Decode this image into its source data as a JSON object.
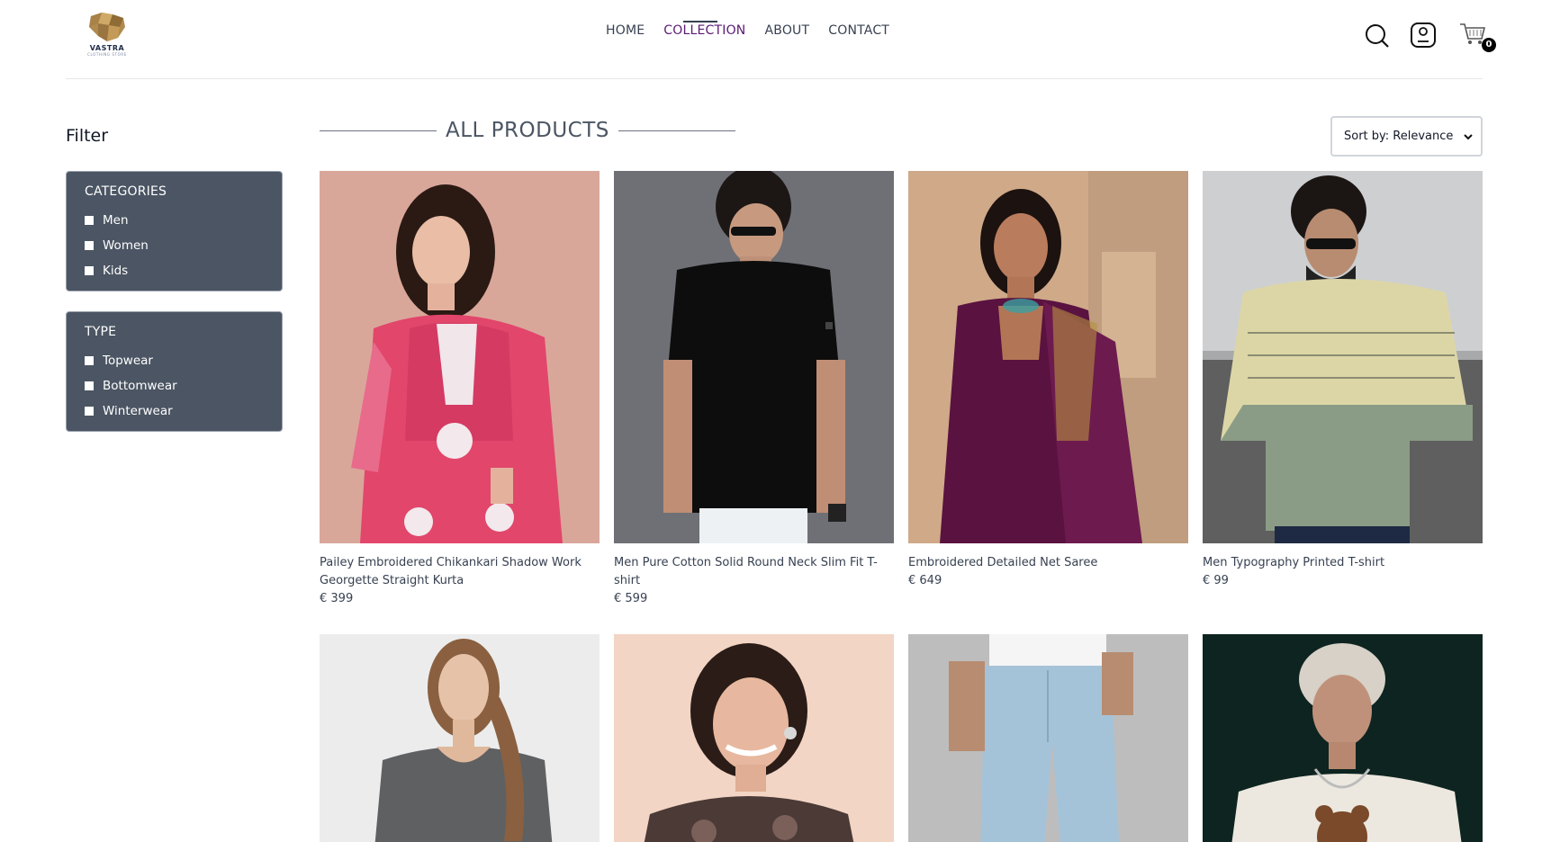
{
  "brand": {
    "name": "VASTRA",
    "tagline": "CLOTHING STORE"
  },
  "nav": {
    "items": [
      {
        "label": "HOME",
        "active": false
      },
      {
        "label": "COLLECTION",
        "active": true
      },
      {
        "label": "ABOUT",
        "active": false
      },
      {
        "label": "CONTACT",
        "active": false
      }
    ]
  },
  "header_icons": {
    "search": "search-icon",
    "profile": "user-icon",
    "cart": "cart-icon",
    "cart_count": "0"
  },
  "filter": {
    "title": "Filter",
    "categories": {
      "heading": "CATEGORIES",
      "options": [
        "Men",
        "Women",
        "Kids"
      ]
    },
    "type": {
      "heading": "TYPE",
      "options": [
        "Topwear",
        "Bottomwear",
        "Winterwear"
      ]
    }
  },
  "main": {
    "title": "ALL PRODUCTS",
    "sort": {
      "selected": "Sort by: Relevance"
    },
    "products": [
      {
        "name": "Pailey Embroidered Chikankari Shadow Work Georgette Straight Kurta",
        "price": "€ 399"
      },
      {
        "name": "Men Pure Cotton Solid Round Neck Slim Fit T-shirt",
        "price": "€ 599"
      },
      {
        "name": "Embroidered Detailed Net Saree",
        "price": "€ 649"
      },
      {
        "name": "Men Typography Printed T-shirt",
        "price": "€ 99"
      },
      {
        "name": "",
        "price": ""
      },
      {
        "name": "",
        "price": ""
      },
      {
        "name": "",
        "price": ""
      },
      {
        "name": "",
        "price": ""
      }
    ]
  },
  "colors": {
    "accent": "#5b1a73",
    "filter_bg": "#4b5563",
    "text": "#374151"
  }
}
